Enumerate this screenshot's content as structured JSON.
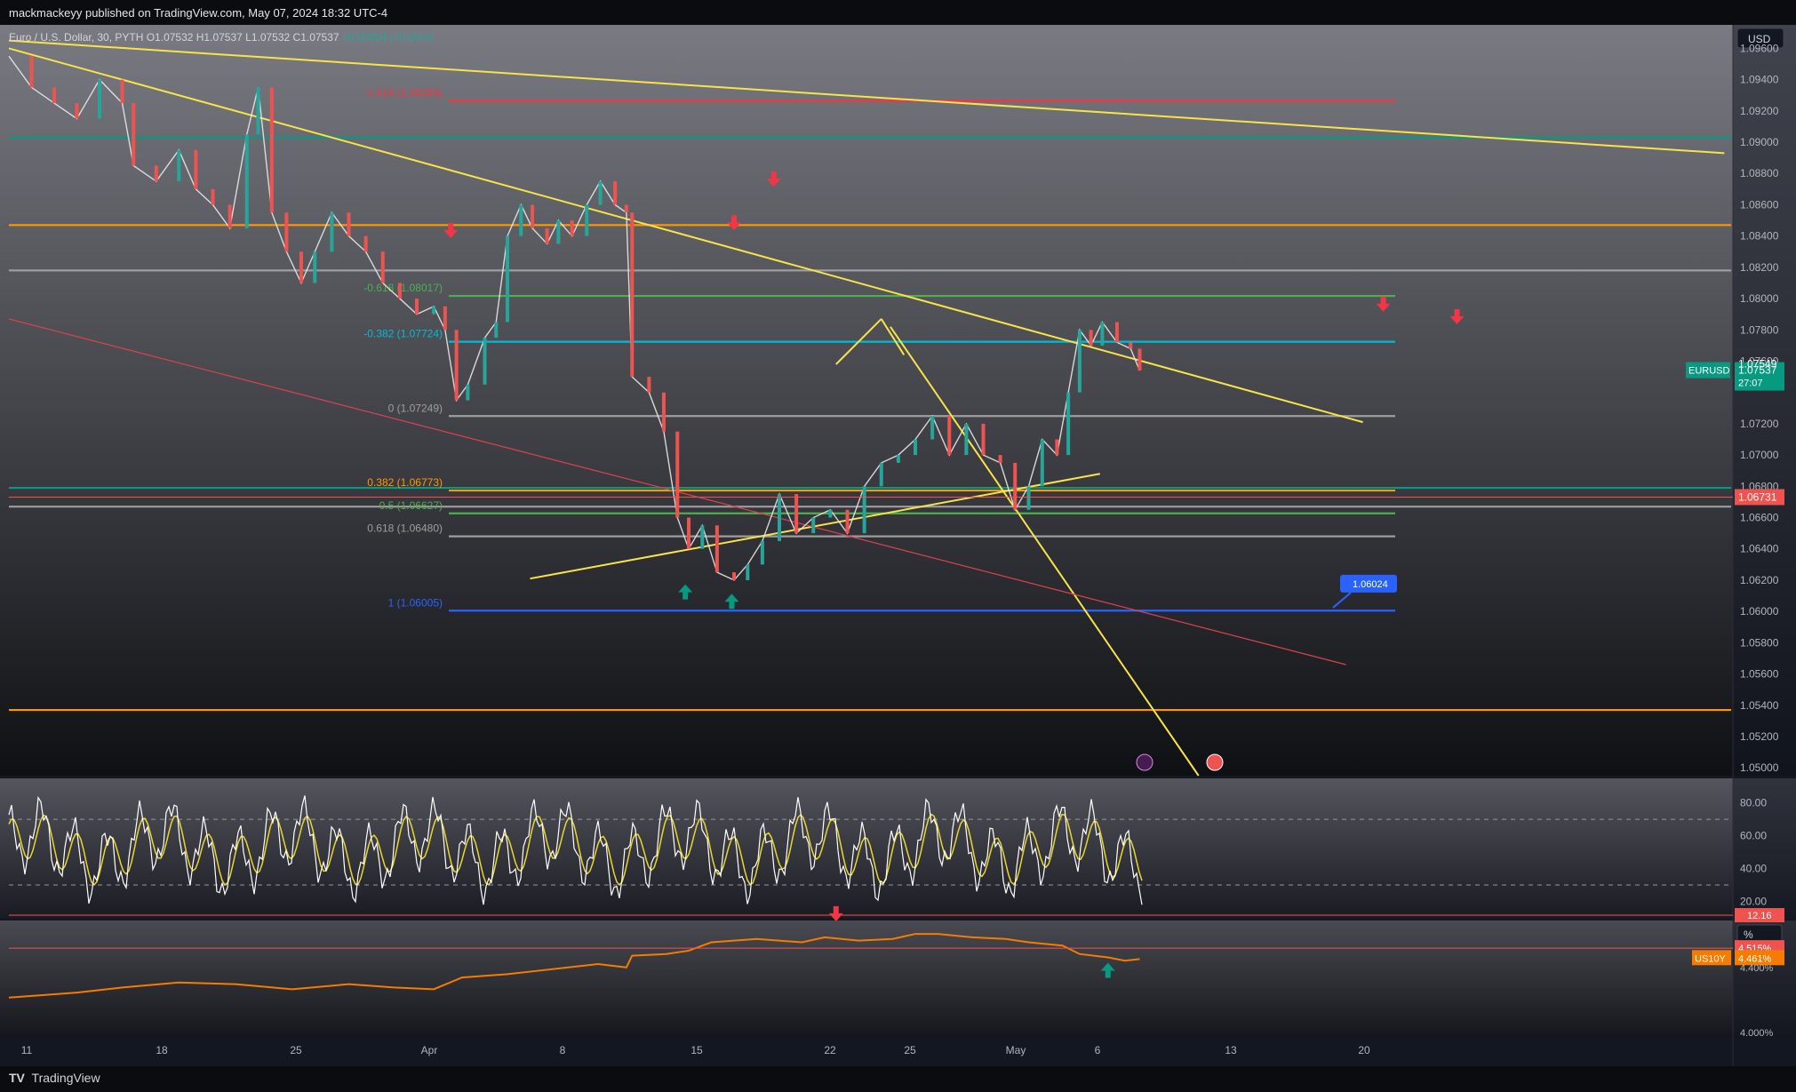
{
  "header": {
    "published": "mackmackeyy published on TradingView.com, May 07, 2024 18:32 UTC-4"
  },
  "footer": {
    "brand": "TradingView",
    "brand_logo": "TV"
  },
  "colors": {
    "background": "#131722",
    "up": "#26a69a",
    "down": "#ef5350",
    "trendline": "#f7e34a",
    "fib_red": "#f23645",
    "fib_green": "#4caf50",
    "fib_cyan": "#00bcd4",
    "fib_gray": "#9e9e9e",
    "fib_orange": "#ff9800",
    "fib_blue": "#2962ff",
    "teal_line": "#089981",
    "orange_line": "#ff9800",
    "rsi_line": "#ffffff",
    "rsi_signal": "#e9d62e",
    "us10y_line": "#f57c00"
  },
  "chart_data": {
    "type": "candlestick",
    "title": "Euro / U.S. Dollar, 30, PYTH",
    "ohlc": {
      "open_label": "O",
      "open": "1.07532",
      "high_label": "H",
      "high": "1.07537",
      "low_label": "L",
      "low": "1.07532",
      "close_label": "C",
      "close": "1.07537",
      "change": "+0.00004 (+0.00%)"
    },
    "currency": "USD",
    "x_ticks": [
      "11",
      "18",
      "25",
      "Apr",
      "8",
      "15",
      "22",
      "25",
      "May",
      "6",
      "13",
      "20"
    ],
    "y_ticks": [
      "1.09600",
      "1.09400",
      "1.09200",
      "1.09000",
      "1.08800",
      "1.08600",
      "1.08400",
      "1.08200",
      "1.08000",
      "1.07800",
      "1.07600",
      "1.07200",
      "1.07000",
      "1.06800",
      "1.06600",
      "1.06400",
      "1.06200",
      "1.06000",
      "1.05800",
      "1.05600",
      "1.05400",
      "1.05200",
      "1.05000"
    ],
    "ylim": [
      1.0495,
      1.0975
    ],
    "price_labels": {
      "symbol": "EURUSD",
      "last": "1.07537",
      "countdown": "27:07",
      "level_a": "1.07549",
      "level_b": "1.06731"
    },
    "price_path": [
      [
        0,
        1.0955
      ],
      [
        20,
        1.0935
      ],
      [
        40,
        1.0925
      ],
      [
        60,
        1.0915
      ],
      [
        80,
        1.094
      ],
      [
        100,
        1.0925
      ],
      [
        110,
        1.0885
      ],
      [
        130,
        1.0875
      ],
      [
        150,
        1.0895
      ],
      [
        165,
        1.087
      ],
      [
        180,
        1.086
      ],
      [
        195,
        1.0845
      ],
      [
        210,
        1.0905
      ],
      [
        220,
        1.0935
      ],
      [
        232,
        1.0855
      ],
      [
        245,
        1.083
      ],
      [
        258,
        1.081
      ],
      [
        270,
        1.083
      ],
      [
        285,
        1.0855
      ],
      [
        300,
        1.084
      ],
      [
        315,
        1.083
      ],
      [
        330,
        1.081
      ],
      [
        345,
        1.08
      ],
      [
        360,
        1.079
      ],
      [
        375,
        1.0795
      ],
      [
        385,
        1.078
      ],
      [
        395,
        1.0735
      ],
      [
        405,
        1.0745
      ],
      [
        420,
        1.0775
      ],
      [
        430,
        1.0785
      ],
      [
        440,
        1.084
      ],
      [
        452,
        1.086
      ],
      [
        462,
        1.0845
      ],
      [
        475,
        1.0835
      ],
      [
        485,
        1.085
      ],
      [
        497,
        1.084
      ],
      [
        510,
        1.086
      ],
      [
        522,
        1.0875
      ],
      [
        535,
        1.086
      ],
      [
        545,
        1.0855
      ],
      [
        550,
        1.075
      ],
      [
        565,
        1.074
      ],
      [
        578,
        1.0715
      ],
      [
        590,
        1.066
      ],
      [
        600,
        1.064
      ],
      [
        612,
        1.0655
      ],
      [
        625,
        1.0625
      ],
      [
        640,
        1.062
      ],
      [
        652,
        1.063
      ],
      [
        665,
        1.0645
      ],
      [
        680,
        1.0675
      ],
      [
        695,
        1.065
      ],
      [
        710,
        1.066
      ],
      [
        725,
        1.0665
      ],
      [
        740,
        1.065
      ],
      [
        755,
        1.068
      ],
      [
        770,
        1.0695
      ],
      [
        785,
        1.07
      ],
      [
        800,
        1.071
      ],
      [
        815,
        1.0725
      ],
      [
        830,
        1.07
      ],
      [
        845,
        1.072
      ],
      [
        860,
        1.07
      ],
      [
        875,
        1.0695
      ],
      [
        888,
        1.0665
      ],
      [
        900,
        1.068
      ],
      [
        912,
        1.071
      ],
      [
        925,
        1.07
      ],
      [
        935,
        1.074
      ],
      [
        945,
        1.078
      ],
      [
        955,
        1.077
      ],
      [
        965,
        1.0785
      ],
      [
        978,
        1.0772
      ],
      [
        990,
        1.0768
      ],
      [
        998,
        1.0754
      ]
    ],
    "fib_levels": [
      {
        "label": "-1.618 (1.09265)",
        "value": 1.09265,
        "color": "#f23645"
      },
      {
        "label": "-0.618 (1.08017)",
        "value": 1.08017,
        "color": "#4caf50"
      },
      {
        "label": "-0.382 (1.07724)",
        "value": 1.07724,
        "color": "#00bcd4"
      },
      {
        "label": "0 (1.07249)",
        "value": 1.07249,
        "color": "#9e9e9e"
      },
      {
        "label": "0.382 (1.06773)",
        "value": 1.06773,
        "color": "#ff9800"
      },
      {
        "label": "0.5 (1.06627)",
        "value": 1.06627,
        "color": "#4caf50"
      },
      {
        "label": "0.618 (1.06480)",
        "value": 1.0648,
        "color": "#9e9e9e"
      },
      {
        "label": "1 (1.06005)",
        "value": 1.06005,
        "color": "#2962ff"
      }
    ],
    "horizontal_lines": [
      {
        "value": 1.0903,
        "color": "#089981"
      },
      {
        "value": 1.0847,
        "color": "#ff9800"
      },
      {
        "value": 1.0818,
        "color": "#9e9e9e"
      },
      {
        "value": 1.0679,
        "color": "#089981"
      },
      {
        "value": 1.0667,
        "color": "#9e9e9e"
      },
      {
        "value": 1.0537,
        "color": "#ff9800"
      }
    ],
    "target_label": "1.06024",
    "rsi": {
      "y_ticks": [
        "80.00",
        "60.00",
        "40.00",
        "20.00"
      ],
      "ylim": [
        10,
        95
      ],
      "level_label": "12.16"
    },
    "us10y": {
      "currency": "%",
      "symbol": "US10Y",
      "value_a": "4.515%",
      "value_b": "4.461%",
      "y_ticks": [
        "4.400%",
        "4.000%"
      ],
      "path": [
        [
          0,
          4.22
        ],
        [
          60,
          4.25
        ],
        [
          100,
          4.28
        ],
        [
          150,
          4.31
        ],
        [
          200,
          4.3
        ],
        [
          250,
          4.27
        ],
        [
          300,
          4.3
        ],
        [
          340,
          4.28
        ],
        [
          375,
          4.27
        ],
        [
          400,
          4.34
        ],
        [
          440,
          4.36
        ],
        [
          480,
          4.39
        ],
        [
          520,
          4.42
        ],
        [
          545,
          4.4
        ],
        [
          550,
          4.47
        ],
        [
          580,
          4.48
        ],
        [
          600,
          4.5
        ],
        [
          620,
          4.55
        ],
        [
          660,
          4.57
        ],
        [
          700,
          4.55
        ],
        [
          720,
          4.58
        ],
        [
          750,
          4.56
        ],
        [
          780,
          4.57
        ],
        [
          800,
          4.6
        ],
        [
          820,
          4.6
        ],
        [
          850,
          4.58
        ],
        [
          880,
          4.57
        ],
        [
          900,
          4.55
        ],
        [
          930,
          4.53
        ],
        [
          945,
          4.48
        ],
        [
          970,
          4.46
        ],
        [
          985,
          4.44
        ],
        [
          998,
          4.45
        ]
      ],
      "ylim": [
        3.98,
        4.68
      ]
    }
  }
}
